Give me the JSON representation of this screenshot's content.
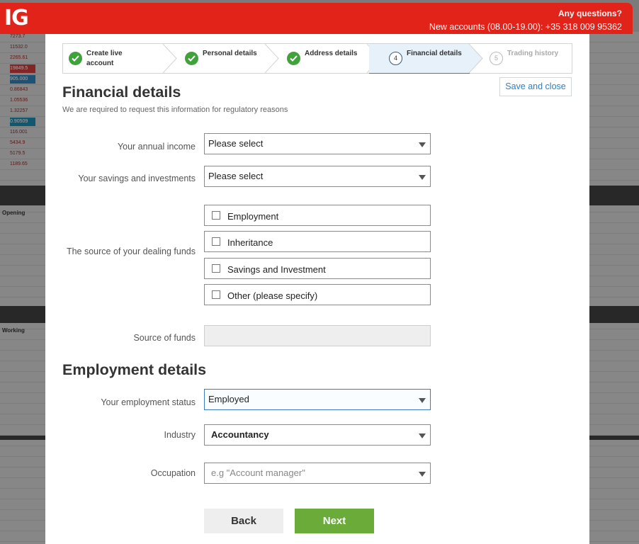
{
  "header": {
    "logo": "IG",
    "questions_label": "Any questions?",
    "phone_text": "New accounts (08.00-19.00): +35 318 009 95362",
    "brand_color": "#e2231a"
  },
  "background": {
    "cells": [
      "7273.7",
      "11532.0",
      "2265.61",
      "19849.5",
      "905.000",
      "0.86843",
      "1.05536",
      "1.32257",
      "0.90509",
      "116.001",
      "5434.9",
      "5179.5",
      "1189.65"
    ],
    "label_opening": "Opening",
    "label_working": "Working"
  },
  "stepper": {
    "steps": [
      {
        "number": "",
        "label": "Create live account",
        "state": "done"
      },
      {
        "number": "",
        "label": "Personal details",
        "state": "done"
      },
      {
        "number": "",
        "label": "Address details",
        "state": "done"
      },
      {
        "number": "4",
        "label": "Financial details",
        "state": "current"
      },
      {
        "number": "5",
        "label": "Trading history",
        "state": "todo"
      }
    ]
  },
  "financial": {
    "title": "Financial details",
    "subtitle": "We are required to request this information for regulatory reasons",
    "save_close": "Save and close",
    "annual_income_label": "Your annual income",
    "annual_income_value": "Please select",
    "savings_label": "Your savings and investments",
    "savings_value": "Please select",
    "source_label": "The source of your dealing funds",
    "source_options": [
      "Employment",
      "Inheritance",
      "Savings and Investment",
      "Other (please specify)"
    ],
    "source_of_funds_label": "Source of funds",
    "source_of_funds_value": ""
  },
  "employment": {
    "title": "Employment details",
    "status_label": "Your employment status",
    "status_value": "Employed",
    "industry_label": "Industry",
    "industry_value": "Accountancy",
    "occupation_label": "Occupation",
    "occupation_placeholder": "e.g \"Account manager\""
  },
  "actions": {
    "back": "Back",
    "next": "Next",
    "next_color": "#6aab3a"
  }
}
